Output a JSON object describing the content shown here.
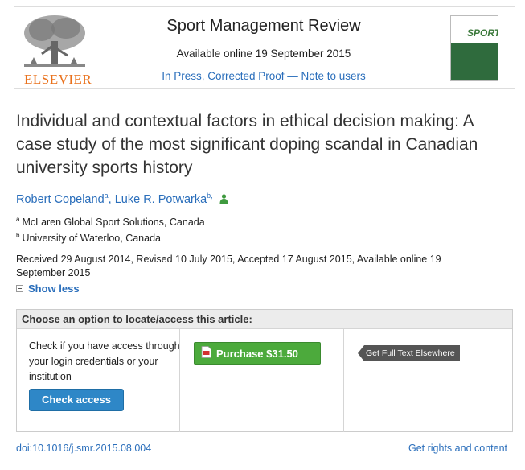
{
  "publisher": {
    "name": "ELSEVIER"
  },
  "journal": {
    "title": "Sport Management Review",
    "available_online": "Available online 19 September 2015",
    "status_link": "In Press, Corrected Proof — Note to users",
    "cover_word": "SPORT"
  },
  "article": {
    "title": "Individual and contextual factors in ethical decision making: A case study of the most significant doping scandal in Canadian university sports history",
    "authors": [
      {
        "name": "Robert Copeland",
        "sup": "a"
      },
      {
        "name": "Luke R. Potwarka",
        "sup": "b,"
      }
    ],
    "affiliations": [
      {
        "sup": "a",
        "text": "McLaren Global Sport Solutions, Canada"
      },
      {
        "sup": "b",
        "text": "University of Waterloo, Canada"
      }
    ],
    "history": "Received 29 August 2014, Revised 10 July 2015, Accepted 17 August 2015, Available online 19 September 2015",
    "show_less": "Show less"
  },
  "access": {
    "heading": "Choose an option to locate/access this article:",
    "check_text": "Check if you have access through your login credentials or your institution",
    "check_button": "Check access",
    "purchase_button": "Purchase $31.50",
    "fulltext_button": "Get Full Text Elsewhere"
  },
  "footer": {
    "doi": "doi:10.1016/j.smr.2015.08.004",
    "rights": "Get rights and content"
  },
  "colors": {
    "link": "#2a6ebb",
    "purchase": "#4caa3c",
    "check_access": "#2e87c7",
    "publisher": "#e9711c"
  }
}
